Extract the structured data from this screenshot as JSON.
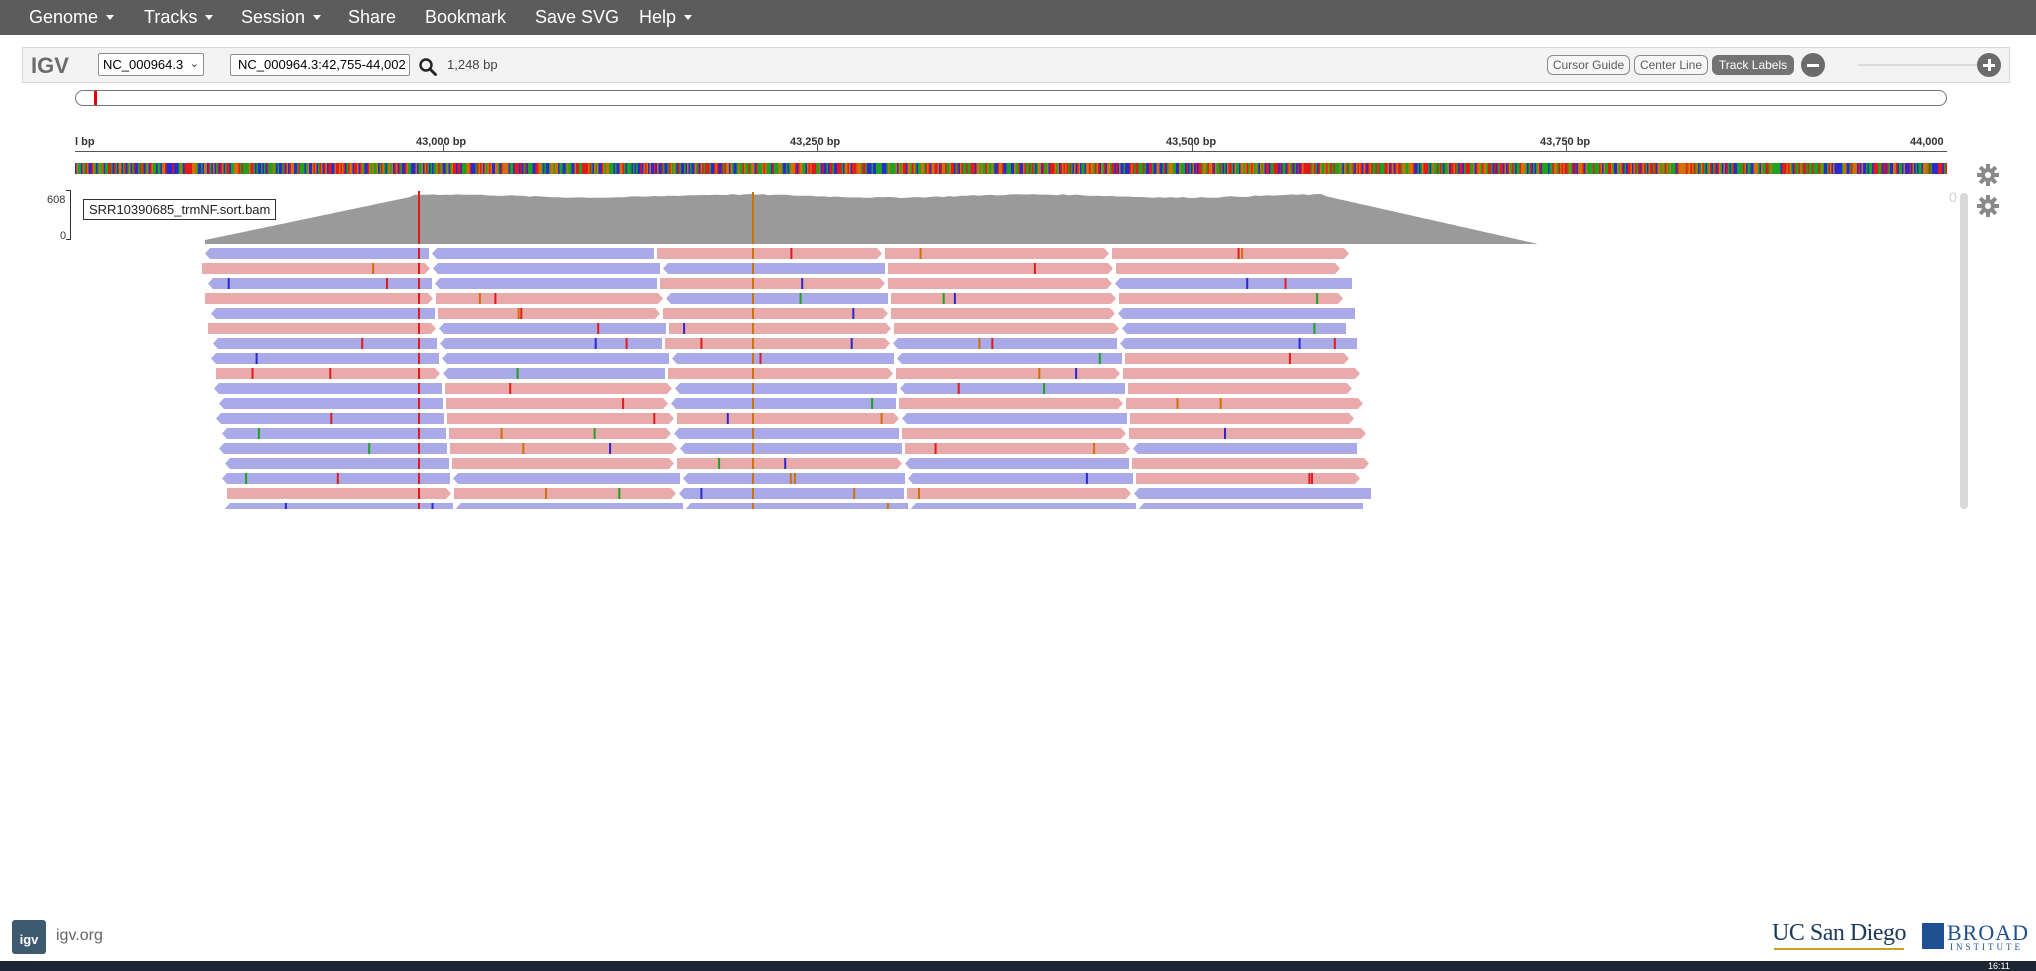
{
  "menu": {
    "genome": "Genome",
    "tracks": "Tracks",
    "session": "Session",
    "share": "Share",
    "bookmark": "Bookmark",
    "save_svg": "Save SVG",
    "help": "Help"
  },
  "navbar": {
    "logo": "IGV",
    "genome_value": "NC_000964.3",
    "locus_value": "NC_000964.3:42,755-44,002",
    "window_size": "1,248 bp",
    "cursor_guide": "Cursor Guide",
    "center_line": "Center Line",
    "track_labels": "Track Labels"
  },
  "ruler": {
    "labels": [
      "l bp",
      "43,000 bp",
      "43,250 bp",
      "43,500 bp",
      "43,750 bp",
      "44,000"
    ]
  },
  "track": {
    "name": "SRR10390685_trmNF.sort.bam",
    "coverage_max": "608",
    "coverage_min": "0",
    "scroll_indicator": "0"
  },
  "colors": {
    "menubar": "#5c5c5c",
    "forward_read": "#e8aaaa",
    "reverse_read": "#aaaae8",
    "coverage": "#9a9a9a",
    "mismatch_A": "#1fa21f",
    "mismatch_C": "#2a2ad0",
    "mismatch_G": "#d17105",
    "mismatch_T": "#e11b1b"
  },
  "footer": {
    "site": "igv.org",
    "ucsd": "UC San Diego",
    "broad": "BROAD",
    "broad_sub": "INSTITUTE",
    "logo_text": "igv"
  },
  "taskbar": {
    "clock": "16:11"
  }
}
